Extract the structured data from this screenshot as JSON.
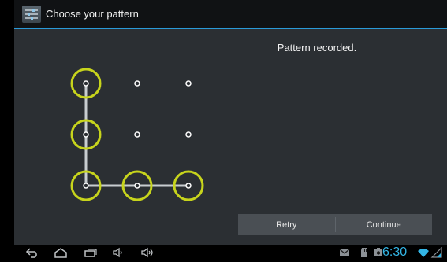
{
  "titlebar": {
    "title": "Choose your pattern",
    "icon": "settings-app-icon"
  },
  "main": {
    "header": "Pattern recorded.",
    "grid": {
      "rows": 3,
      "cols": 3,
      "selected_sequence": [
        1,
        4,
        7,
        8,
        9
      ]
    },
    "buttons": {
      "retry_label": "Retry",
      "continue_label": "Continue"
    }
  },
  "navbar": {
    "icons": [
      "back-icon",
      "home-icon",
      "recent-apps-icon",
      "volume-down-icon",
      "volume-up-icon",
      "gmail-notification-icon",
      "sd-card-icon",
      "screenshot-icon",
      "wifi-icon",
      "battery-icon"
    ],
    "time": "6:30"
  },
  "colors": {
    "accent": "#33b5e5",
    "ring": "#c7d41c",
    "background": "#2b2f33"
  }
}
